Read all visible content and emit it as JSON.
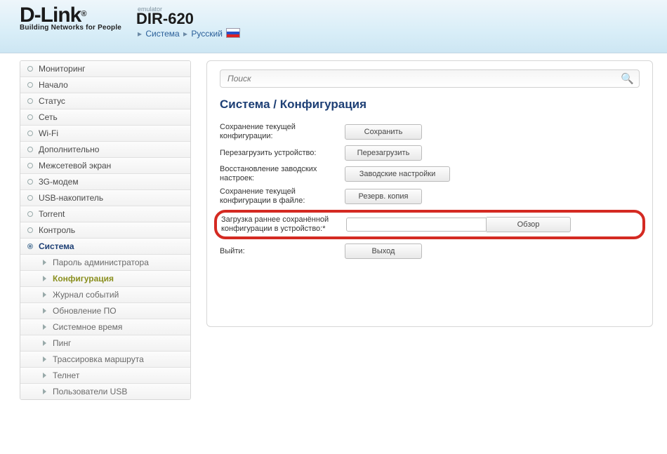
{
  "header": {
    "brand": "D-Link",
    "tagline": "Building Networks for People",
    "emulator": "emulator",
    "model": "DIR-620",
    "crumb_system": "Система",
    "crumb_lang": "Русский"
  },
  "search": {
    "placeholder": "Поиск"
  },
  "sidebar": {
    "items": [
      {
        "label": "Мониторинг"
      },
      {
        "label": "Начало"
      },
      {
        "label": "Статус"
      },
      {
        "label": "Сеть"
      },
      {
        "label": "Wi-Fi"
      },
      {
        "label": "Дополнительно"
      },
      {
        "label": "Межсетевой экран"
      },
      {
        "label": "3G-модем"
      },
      {
        "label": "USB-накопитель"
      },
      {
        "label": "Torrent"
      },
      {
        "label": "Контроль"
      },
      {
        "label": "Система"
      }
    ],
    "subitems": [
      {
        "label": "Пароль администратора"
      },
      {
        "label": "Конфигурация"
      },
      {
        "label": "Журнал событий"
      },
      {
        "label": "Обновление ПО"
      },
      {
        "label": "Системное время"
      },
      {
        "label": "Пинг"
      },
      {
        "label": "Трассировка маршрута"
      },
      {
        "label": "Телнет"
      },
      {
        "label": "Пользователи USB"
      }
    ]
  },
  "page": {
    "title": "Система /  Конфигурация",
    "rows": {
      "save_label": "Сохранение текущей конфигурации:",
      "save_btn": "Сохранить",
      "reboot_label": "Перезагрузить устройство:",
      "reboot_btn": "Перезагрузить",
      "factory_label": "Восстановление заводских настроек:",
      "factory_btn": "Заводские настройки",
      "backup_label": "Сохранение текущей конфигурации в файле:",
      "backup_btn": "Резерв. копия",
      "upload_label": "Загрузка раннее сохранённой конфигурации в устройство:*",
      "browse_btn": "Обзор",
      "exit_label": "Выйти:",
      "exit_btn": "Выход"
    }
  }
}
